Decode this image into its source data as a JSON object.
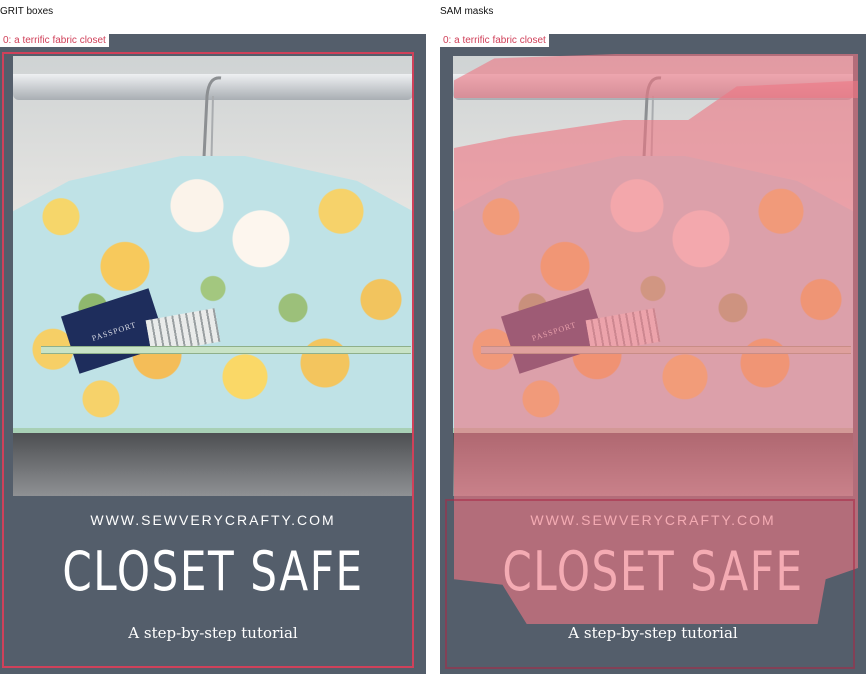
{
  "panels": [
    {
      "title": "GRIT boxes",
      "box_label": "0: a terrific fabric closet",
      "poster": {
        "passport_text": "PASSPORT",
        "url": "WWW.SEWVERYCRAFTY.COM",
        "heading": "CLOSET SAFE",
        "subtitle": "A step-by-step tutorial"
      }
    },
    {
      "title": "SAM masks",
      "box_label": "0: a terrific fabric closet",
      "poster": {
        "passport_text": "PASSPORT",
        "url": "WWW.SEWVERYCRAFTY.COM",
        "heading": "CLOSET SAFE",
        "subtitle": "A step-by-step tutorial"
      }
    }
  ],
  "colors": {
    "box_outline": "#d0415a",
    "mask_fill": "#ee7884",
    "poster_background": "#545e6b"
  }
}
